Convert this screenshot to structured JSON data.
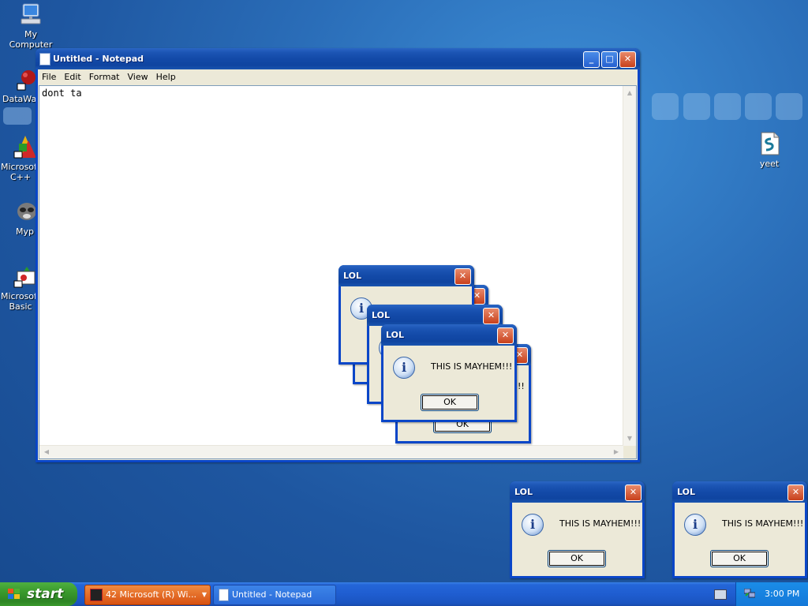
{
  "desktop": {
    "icons": [
      {
        "label": "My Computer",
        "icon": "my-computer-icon"
      },
      {
        "label": "DataWa",
        "icon": "datawave-icon"
      },
      {
        "label": "Microsoft C++",
        "icon": "microsoft-cpp-icon"
      },
      {
        "label": "Myp",
        "icon": "raccoon-icon"
      },
      {
        "label": "Microsoft Basic",
        "icon": "microsoft-basic-icon"
      },
      {
        "label": "yeet",
        "icon": "script-file-icon"
      }
    ]
  },
  "notepad": {
    "title": "Untitled - Notepad",
    "menu": [
      "File",
      "Edit",
      "Format",
      "View",
      "Help"
    ],
    "content": "dont ta"
  },
  "dialogs": {
    "title": "LOL",
    "message": "THIS IS MAYHEM!!!",
    "ok_label": "OK",
    "partial_message": "!!",
    "info_glyph": "i"
  },
  "taskbar": {
    "start_label": "start",
    "items": [
      {
        "label": "42 Microsoft (R) Wi...",
        "active": true
      },
      {
        "label": "Untitled - Notepad",
        "active": false
      }
    ],
    "clock": "3:00 PM"
  },
  "colors": {
    "title_active": "#0f44a0",
    "close_button": "#c8401c",
    "start_green": "#3a9a2c",
    "taskbar_blue": "#1f5dd0",
    "tray_blue": "#1478d8",
    "active_task_orange": "#e8601c"
  }
}
